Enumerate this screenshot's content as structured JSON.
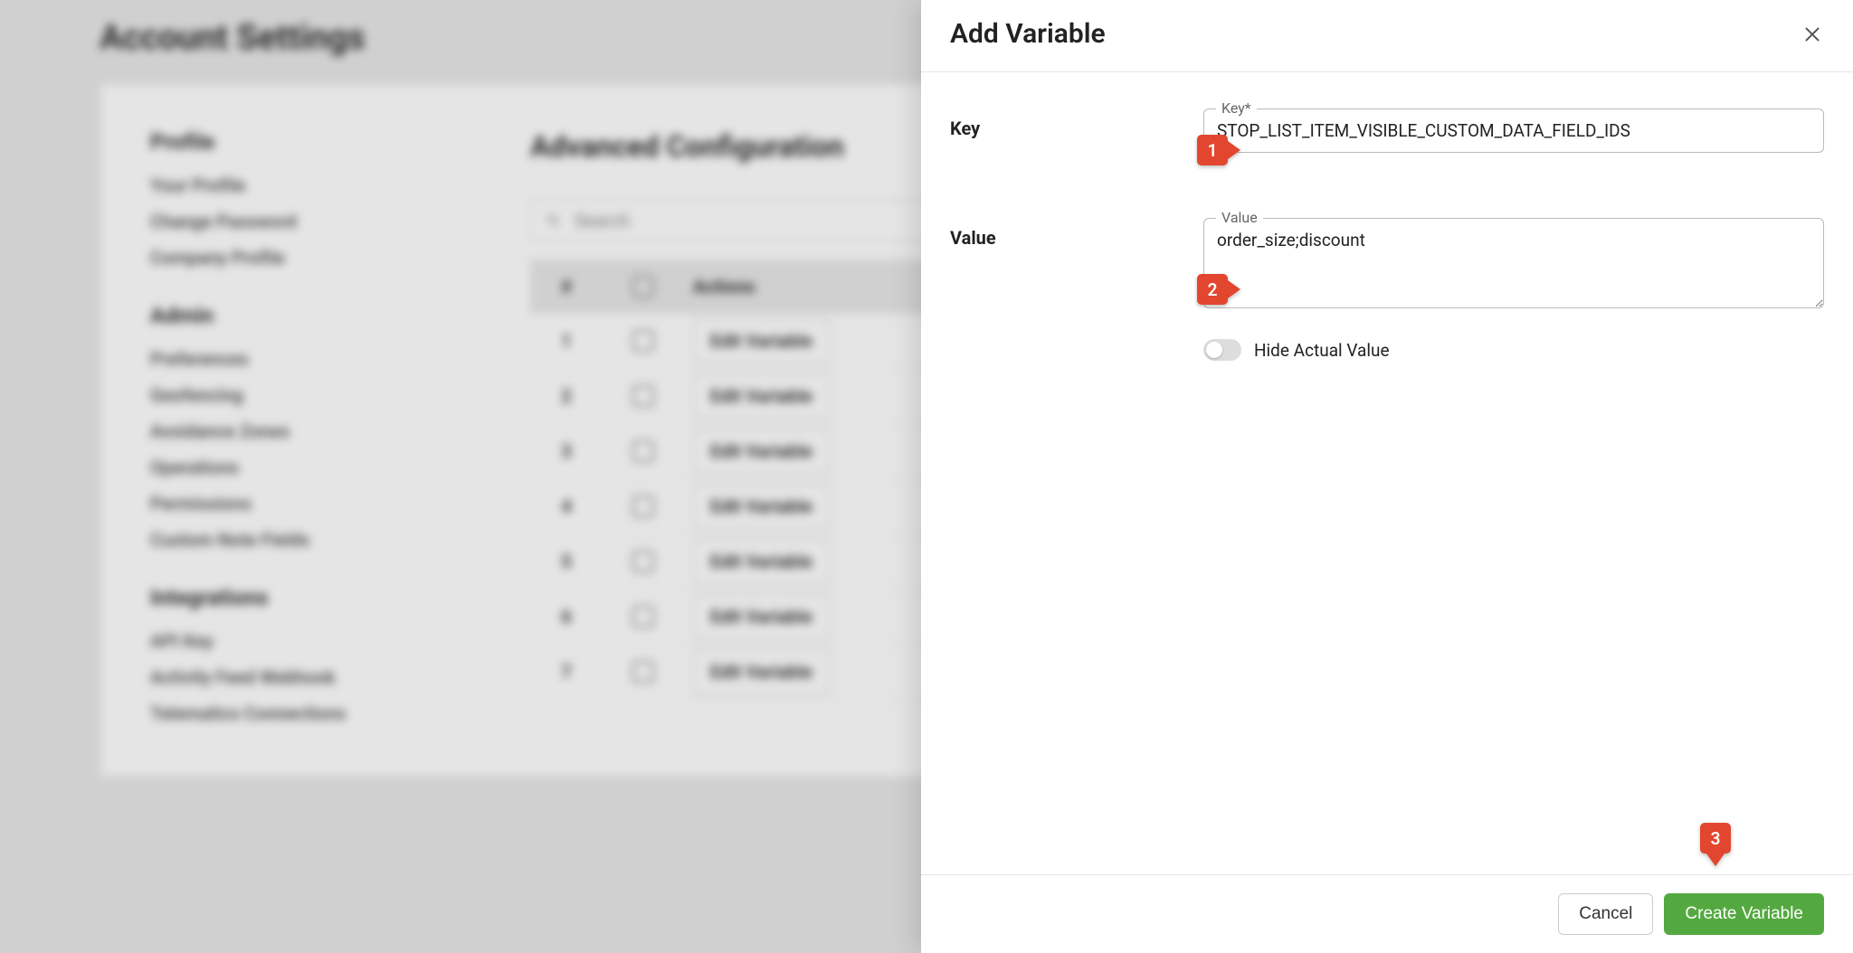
{
  "bg": {
    "page_title": "Account Settings",
    "sections": {
      "profile": {
        "title": "Profile",
        "links": [
          "Your Profile",
          "Change Password",
          "Company Profile"
        ]
      },
      "admin": {
        "title": "Admin",
        "links": [
          "Preferences",
          "Geofencing",
          "Avoidance Zones",
          "Operations",
          "Permissions",
          "Custom Note Fields"
        ]
      },
      "integrations": {
        "title": "Integrations",
        "links": [
          "API Key",
          "Activity Feed Webhook",
          "Telematics Connections"
        ]
      }
    },
    "main_title": "Advanced Configuration",
    "search_placeholder": "Search",
    "columns": {
      "num": "#",
      "actions": "Actions"
    },
    "row_button": "Edit Variable",
    "rows": [
      1,
      2,
      3,
      4,
      5,
      6,
      7
    ]
  },
  "modal": {
    "title": "Add Variable",
    "key_label": "Key",
    "key_float": "Key*",
    "key_value": "STOP_LIST_ITEM_VISIBLE_CUSTOM_DATA_FIELD_IDS",
    "value_label": "Value",
    "value_float": "Value",
    "value_value": "order_size;discount",
    "hide_label": "Hide Actual Value",
    "cancel": "Cancel",
    "create": "Create Variable"
  },
  "markers": {
    "m1": "1",
    "m2": "2",
    "m3": "3"
  }
}
